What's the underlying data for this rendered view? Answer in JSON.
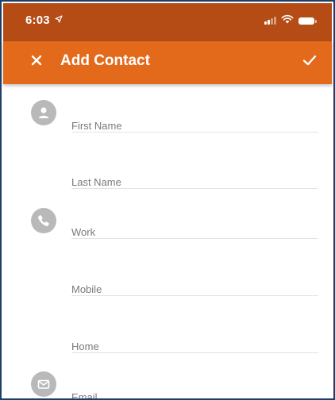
{
  "status_bar": {
    "time": "6:03",
    "location_glyph": "⇗"
  },
  "app_bar": {
    "title": "Add Contact",
    "close_icon": "close-icon",
    "confirm_icon": "checkmark-icon"
  },
  "form": {
    "first_name": {
      "placeholder": "First Name",
      "value": ""
    },
    "last_name": {
      "placeholder": "Last Name",
      "value": ""
    },
    "work": {
      "placeholder": "Work",
      "value": ""
    },
    "mobile": {
      "placeholder": "Mobile",
      "value": ""
    },
    "home": {
      "placeholder": "Home",
      "value": ""
    },
    "email": {
      "placeholder": "Email",
      "value": ""
    }
  },
  "colors": {
    "status_bar": "#b54c15",
    "app_bar": "#e46a1b",
    "icon_grey": "#b9b9b9",
    "divider": "#e3e3e3",
    "frame_border": "#1f3f6b"
  }
}
